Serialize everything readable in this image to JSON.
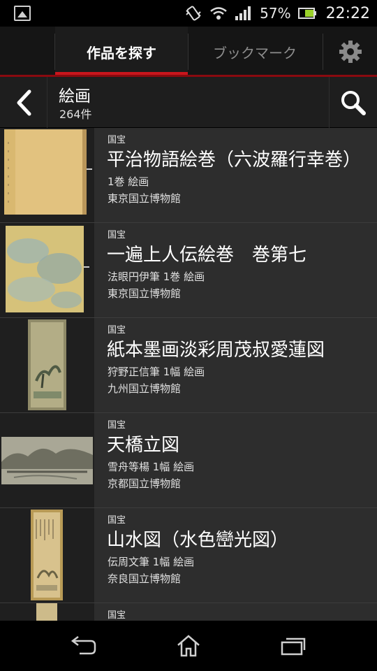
{
  "status": {
    "battery_pct": "57%",
    "time": "22:22",
    "icons": [
      "gallery-icon",
      "vibrate-icon",
      "wifi-icon",
      "signal-icon",
      "battery-icon"
    ]
  },
  "tabs": [
    {
      "label": "作品を探す",
      "active": true
    },
    {
      "label": "ブックマーク",
      "active": false
    }
  ],
  "header": {
    "title": "絵画",
    "count": "264件"
  },
  "items": [
    {
      "badge": "国宝",
      "title": "平治物語絵巻（六波羅行幸巻）",
      "meta": "1巻 絵画",
      "museum": "東京国立博物館"
    },
    {
      "badge": "国宝",
      "title": "一遍上人伝絵巻　巻第七",
      "meta": "法眼円伊筆 1巻 絵画",
      "museum": "東京国立博物館"
    },
    {
      "badge": "国宝",
      "title": "紙本墨画淡彩周茂叔愛蓮図",
      "meta": "狩野正信筆 1幅 絵画",
      "museum": "九州国立博物館"
    },
    {
      "badge": "国宝",
      "title": "天橋立図",
      "meta": "雪舟等楊 1幅 絵画",
      "museum": "京都国立博物館"
    },
    {
      "badge": "国宝",
      "title": "山水図（水色巒光図）",
      "meta": "伝周文筆 1幅 絵画",
      "museum": "奈良国立博物館"
    },
    {
      "badge": "国宝",
      "title": "",
      "meta": "",
      "museum": ""
    }
  ],
  "colors": {
    "accent": "#c9161d",
    "background": "#2d2d2d"
  }
}
